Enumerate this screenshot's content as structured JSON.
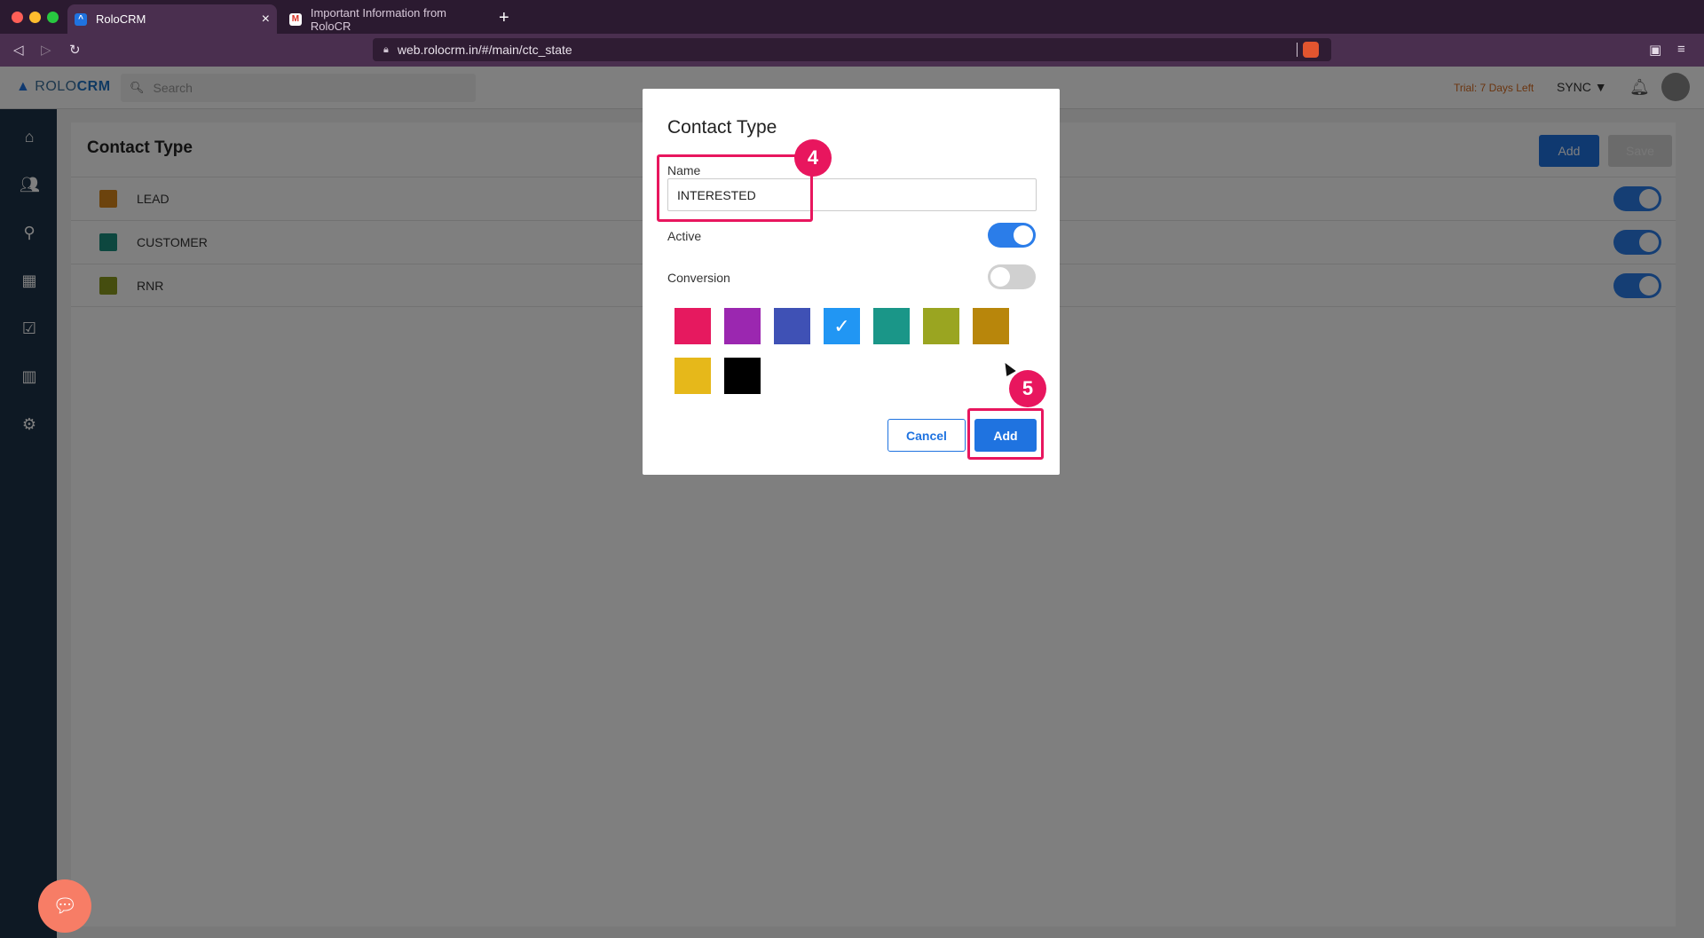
{
  "browser": {
    "tabs": [
      {
        "label": "RoloCRM",
        "favicon": "rolocrm-icon",
        "active": true
      },
      {
        "label": "Important Information from RoloCR",
        "favicon": "gmail-icon",
        "active": false
      }
    ],
    "url": "web.rolocrm.in/#/main/ctc_state"
  },
  "topbar": {
    "logo_rolo": "ROLO",
    "logo_crm": "CRM",
    "search_placeholder": "Search",
    "trial": "Trial: 7 Days Left",
    "sync_label": "SYNC"
  },
  "sidebar": {
    "items": [
      "home-icon",
      "contacts-icon",
      "location-icon",
      "calendar-icon",
      "tasks-icon",
      "reports-icon",
      "settings-icon"
    ]
  },
  "page": {
    "title": "Contact Type",
    "add_label": "Add",
    "save_label": "Save",
    "rows": [
      {
        "label": "LEAD",
        "color": "#d9861a",
        "active": true
      },
      {
        "label": "CUSTOMER",
        "color": "#1a8f7f",
        "active": true
      },
      {
        "label": "RNR",
        "color": "#8a9a1e",
        "active": true
      }
    ]
  },
  "modal": {
    "title": "Contact Type",
    "name_label": "Name",
    "name_value": "INTERESTED",
    "active_label": "Active",
    "active_on": true,
    "conversion_label": "Conversion",
    "conversion_on": false,
    "colors": [
      "#e6195f",
      "#9b27b0",
      "#3f51b5",
      "#2196f3",
      "#1a9688",
      "#9aa521",
      "#b8860b",
      "#e6b81a",
      "#000000"
    ],
    "selected_color_index": 3,
    "cancel_label": "Cancel",
    "add_label": "Add"
  },
  "annotations": {
    "step_4": "4",
    "step_5": "5",
    "color": "#e8165e"
  }
}
